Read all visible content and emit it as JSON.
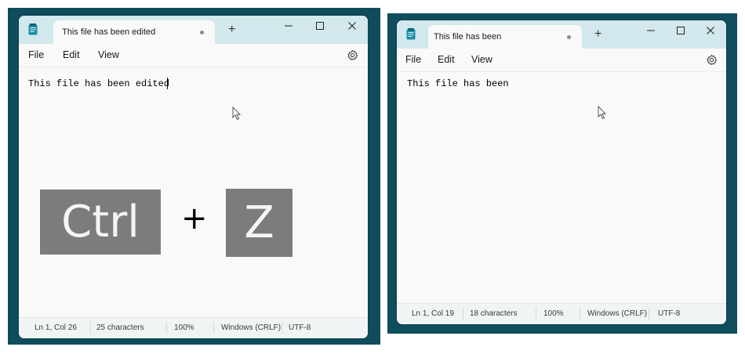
{
  "left_window": {
    "tab_title": "This file has been edited",
    "new_tab": "+",
    "menu": [
      "File",
      "Edit",
      "View"
    ],
    "content": "This file has been edited",
    "status": {
      "position": "Ln 1, Col 26",
      "characters": "25 characters",
      "zoom": "100%",
      "line_ending": "Windows (CRLF)",
      "encoding": "UTF-8"
    }
  },
  "right_window": {
    "tab_title": "This file has been",
    "new_tab": "+",
    "menu": [
      "File",
      "Edit",
      "View"
    ],
    "content": "This file has been",
    "status": {
      "position": "Ln 1, Col 19",
      "characters": "18 characters",
      "zoom": "100%",
      "line_ending": "Windows (CRLF)",
      "encoding": "UTF-8"
    }
  },
  "shortcut": {
    "key1": "Ctrl",
    "operator": "+",
    "key2": "Z"
  },
  "colors": {
    "panel": "#0f4c5c",
    "titlebar": "#d2e8ec",
    "key": "#7c7c7e",
    "app_icon": "#1a8fa6"
  }
}
